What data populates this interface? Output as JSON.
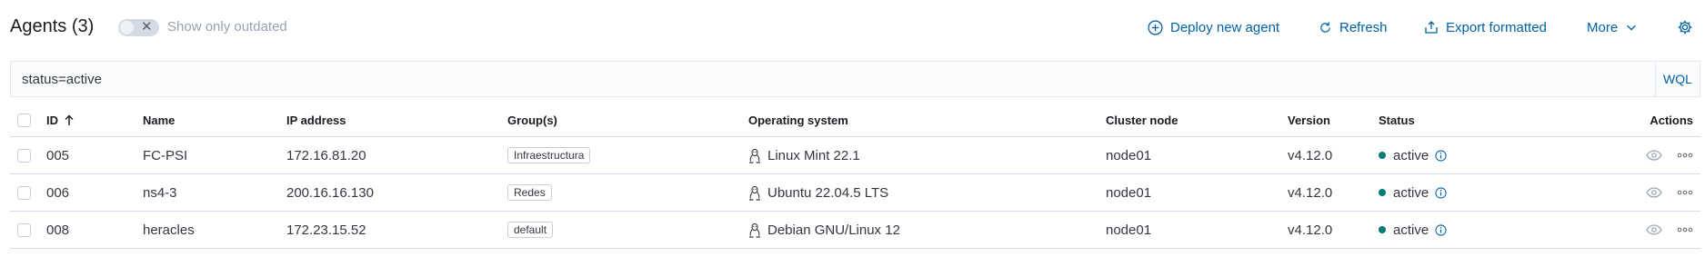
{
  "header": {
    "title": "Agents (3)",
    "toggle_label": "Show only outdated",
    "toggle_on": false,
    "buttons": {
      "deploy": "Deploy new agent",
      "refresh": "Refresh",
      "export": "Export formatted",
      "more": "More"
    },
    "accent_color": "#0061a6"
  },
  "search": {
    "value": "status=active",
    "language_label": "WQL"
  },
  "table": {
    "columns": [
      "ID",
      "Name",
      "IP address",
      "Group(s)",
      "Operating system",
      "Cluster node",
      "Version",
      "Status",
      "Actions"
    ],
    "sorted_column": "ID",
    "sort_direction": "ascending",
    "rows": [
      {
        "id": "005",
        "name": "FC-PSI",
        "ip": "172.16.81.20",
        "group": "Infraestructura",
        "os": "Linux Mint 22.1",
        "node": "node01",
        "version": "v4.12.0",
        "status": "active"
      },
      {
        "id": "006",
        "name": "ns4-3",
        "ip": "200.16.16.130",
        "group": "Redes",
        "os": "Ubuntu 22.04.5 LTS",
        "node": "node01",
        "version": "v4.12.0",
        "status": "active"
      },
      {
        "id": "008",
        "name": "heracles",
        "ip": "172.23.15.52",
        "group": "default",
        "os": "Debian GNU/Linux 12",
        "node": "node01",
        "version": "v4.12.0",
        "status": "active"
      }
    ],
    "status_color": "#017d73",
    "os_icon": "linux-penguin-icon"
  }
}
